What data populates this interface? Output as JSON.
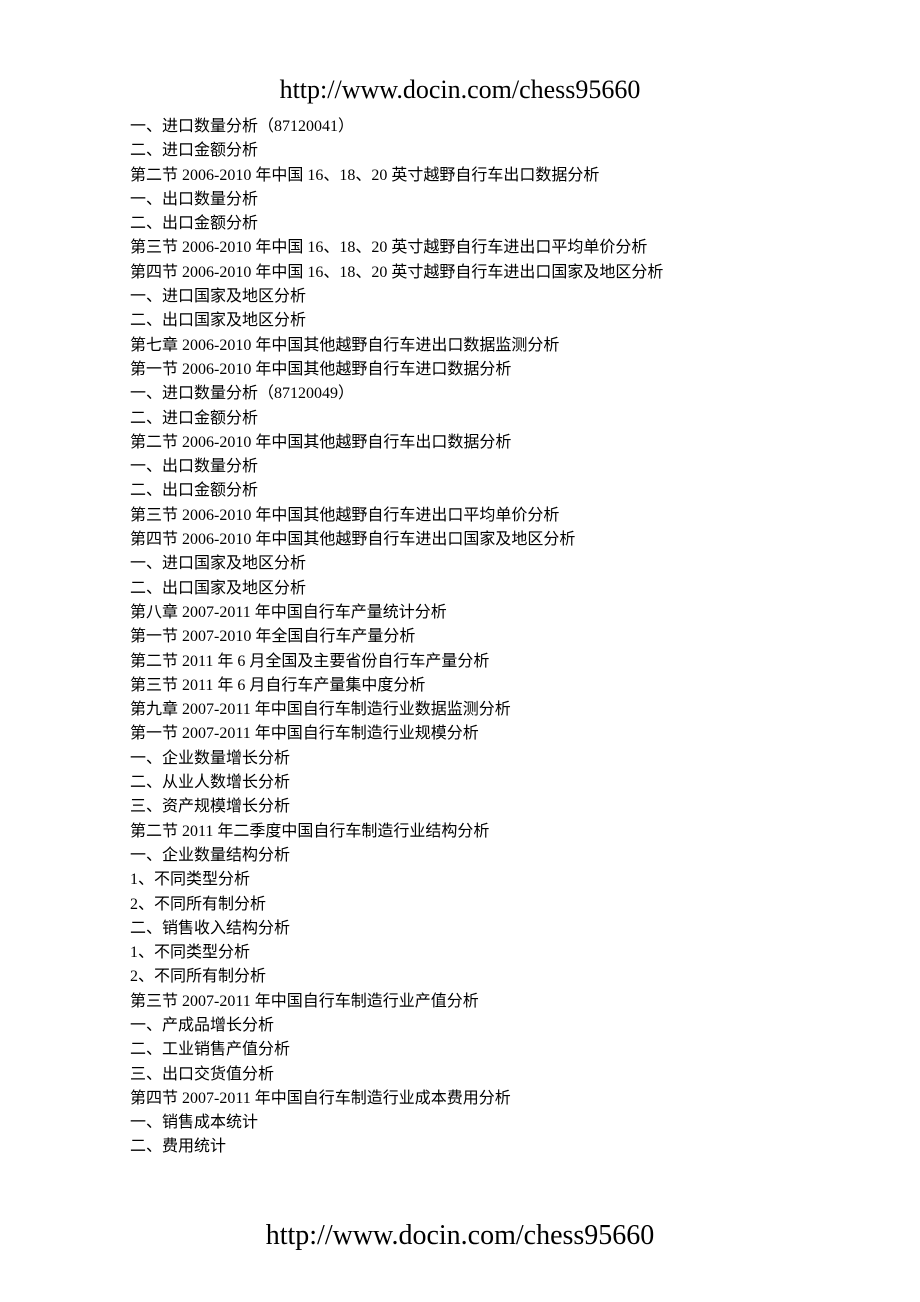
{
  "header_url": "http://www.docin.com/chess95660",
  "footer_url": "http://www.docin.com/chess95660",
  "lines": [
    "一、进口数量分析（87120041）",
    "二、进口金额分析",
    "第二节  2006-2010 年中国 16、18、20 英寸越野自行车出口数据分析",
    "一、出口数量分析",
    "二、出口金额分析",
    "第三节  2006-2010 年中国 16、18、20 英寸越野自行车进出口平均单价分析",
    "第四节  2006-2010 年中国 16、18、20 英寸越野自行车进出口国家及地区分析",
    "一、进口国家及地区分析",
    "二、出口国家及地区分析",
    "第七章  2006-2010 年中国其他越野自行车进出口数据监测分析",
    "第一节  2006-2010 年中国其他越野自行车进口数据分析",
    "一、进口数量分析（87120049）",
    "二、进口金额分析",
    "第二节  2006-2010 年中国其他越野自行车出口数据分析",
    "一、出口数量分析",
    "二、出口金额分析",
    "第三节  2006-2010 年中国其他越野自行车进出口平均单价分析",
    "第四节  2006-2010 年中国其他越野自行车进出口国家及地区分析",
    "一、进口国家及地区分析",
    "二、出口国家及地区分析",
    "第八章  2007-2011 年中国自行车产量统计分析",
    "第一节  2007-2010 年全国自行车产量分析",
    "第二节  2011 年 6 月全国及主要省份自行车产量分析",
    "第三节  2011 年 6 月自行车产量集中度分析",
    "第九章  2007-2011 年中国自行车制造行业数据监测分析",
    "第一节    2007-2011 年中国自行车制造行业规模分析",
    "一、企业数量增长分析",
    "二、从业人数增长分析",
    "三、资产规模增长分析",
    "第二节    2011 年二季度中国自行车制造行业结构分析",
    "一、企业数量结构分析",
    "1、不同类型分析",
    "2、不同所有制分析",
    "二、销售收入结构分析",
    "1、不同类型分析",
    "2、不同所有制分析",
    "第三节    2007-2011 年中国自行车制造行业产值分析",
    "一、产成品增长分析",
    "二、工业销售产值分析",
    "三、出口交货值分析",
    "第四节    2007-2011 年中国自行车制造行业成本费用分析",
    "一、销售成本统计",
    "二、费用统计"
  ]
}
